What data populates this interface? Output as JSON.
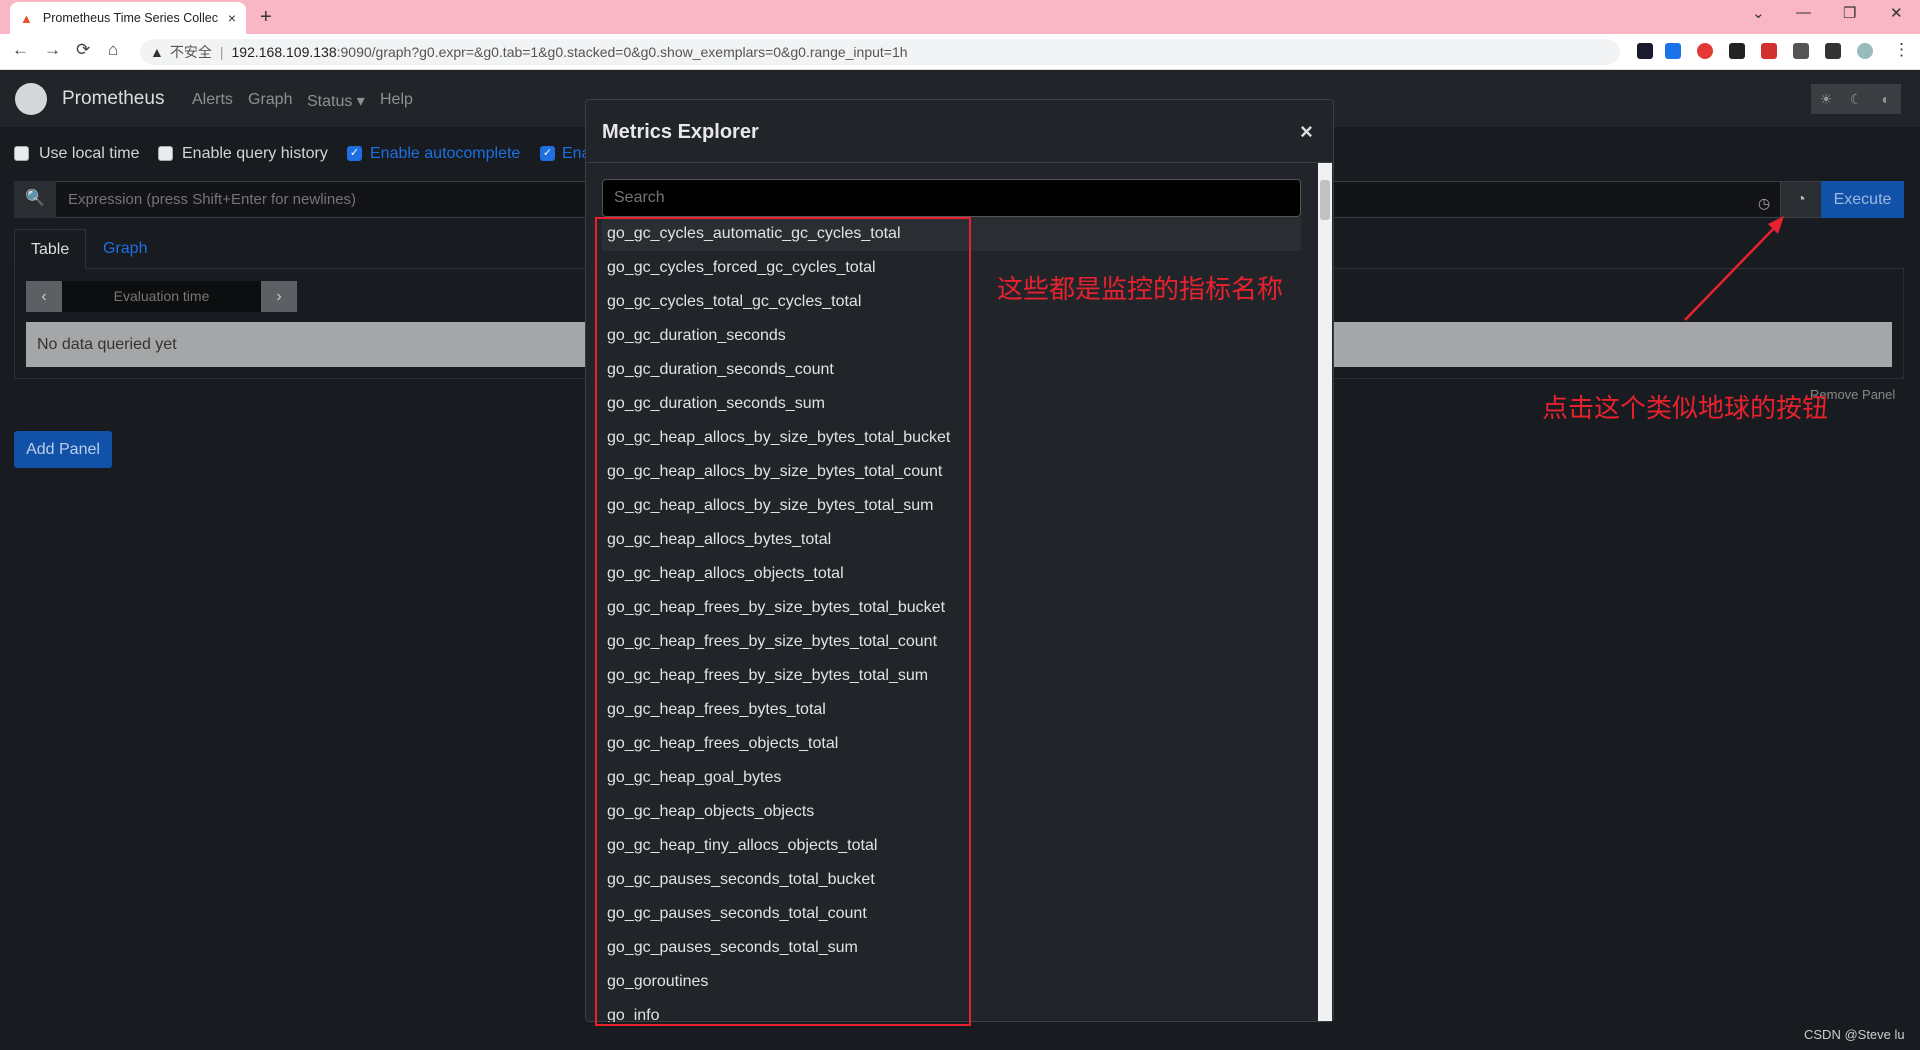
{
  "browser": {
    "tab_title": "Prometheus Time Series Collec",
    "tab_close": "×",
    "new_tab": "+",
    "window_controls": [
      "⌄",
      "—",
      "❐",
      "✕"
    ],
    "nav_buttons": [
      "←",
      "→",
      "⟳",
      "⌂"
    ],
    "omnibox": {
      "warning": "▲",
      "insecure": "不安全",
      "separator": "|",
      "host": "192.168.109.138",
      "path": ":9090/graph?g0.expr=&g0.tab=1&g0.stacked=0&g0.show_exemplars=0&g0.range_input=1h"
    },
    "menu_icon": "⋮"
  },
  "app": {
    "brand": "Prometheus",
    "nav": [
      "Alerts",
      "Graph",
      "Status ▾",
      "Help"
    ],
    "theme_buttons": [
      "☀",
      "☾",
      "◐"
    ]
  },
  "options": {
    "use_local_time": "Use local time",
    "enable_query_history": "Enable query history",
    "enable_autocomplete": "Enable autocomplete",
    "enable_more": "Ena"
  },
  "query": {
    "placeholder": "Expression (press Shift+Enter for newlines)",
    "execute": "Execute",
    "search_icon": "🔍",
    "globe_icon": "◔",
    "history_icon": "◷"
  },
  "panel": {
    "tabs": [
      "Table",
      "Graph"
    ],
    "eval_prev": "‹",
    "eval_time_placeholder": "Evaluation time",
    "eval_next": "›",
    "no_data": "No data queried yet",
    "remove_panel": "Remove Panel",
    "add_panel": "Add Panel"
  },
  "metrics_explorer": {
    "title": "Metrics Explorer",
    "close": "×",
    "search_placeholder": "Search",
    "items": [
      "go_gc_cycles_automatic_gc_cycles_total",
      "go_gc_cycles_forced_gc_cycles_total",
      "go_gc_cycles_total_gc_cycles_total",
      "go_gc_duration_seconds",
      "go_gc_duration_seconds_count",
      "go_gc_duration_seconds_sum",
      "go_gc_heap_allocs_by_size_bytes_total_bucket",
      "go_gc_heap_allocs_by_size_bytes_total_count",
      "go_gc_heap_allocs_by_size_bytes_total_sum",
      "go_gc_heap_allocs_bytes_total",
      "go_gc_heap_allocs_objects_total",
      "go_gc_heap_frees_by_size_bytes_total_bucket",
      "go_gc_heap_frees_by_size_bytes_total_count",
      "go_gc_heap_frees_by_size_bytes_total_sum",
      "go_gc_heap_frees_bytes_total",
      "go_gc_heap_frees_objects_total",
      "go_gc_heap_goal_bytes",
      "go_gc_heap_objects_objects",
      "go_gc_heap_tiny_allocs_objects_total",
      "go_gc_pauses_seconds_total_bucket",
      "go_gc_pauses_seconds_total_count",
      "go_gc_pauses_seconds_total_sum",
      "go_goroutines",
      "go_info"
    ]
  },
  "annotations": {
    "metrics_note": "这些都是监控的指标名称",
    "globe_note": "点击这个类似地球的按钮"
  },
  "watermark": "CSDN @Steve lu",
  "colors": {
    "titlebar": "#f9b6c4",
    "app_bg": "#181b1f",
    "accent": "#1d6fe2",
    "annotation_red": "#e8212e"
  }
}
